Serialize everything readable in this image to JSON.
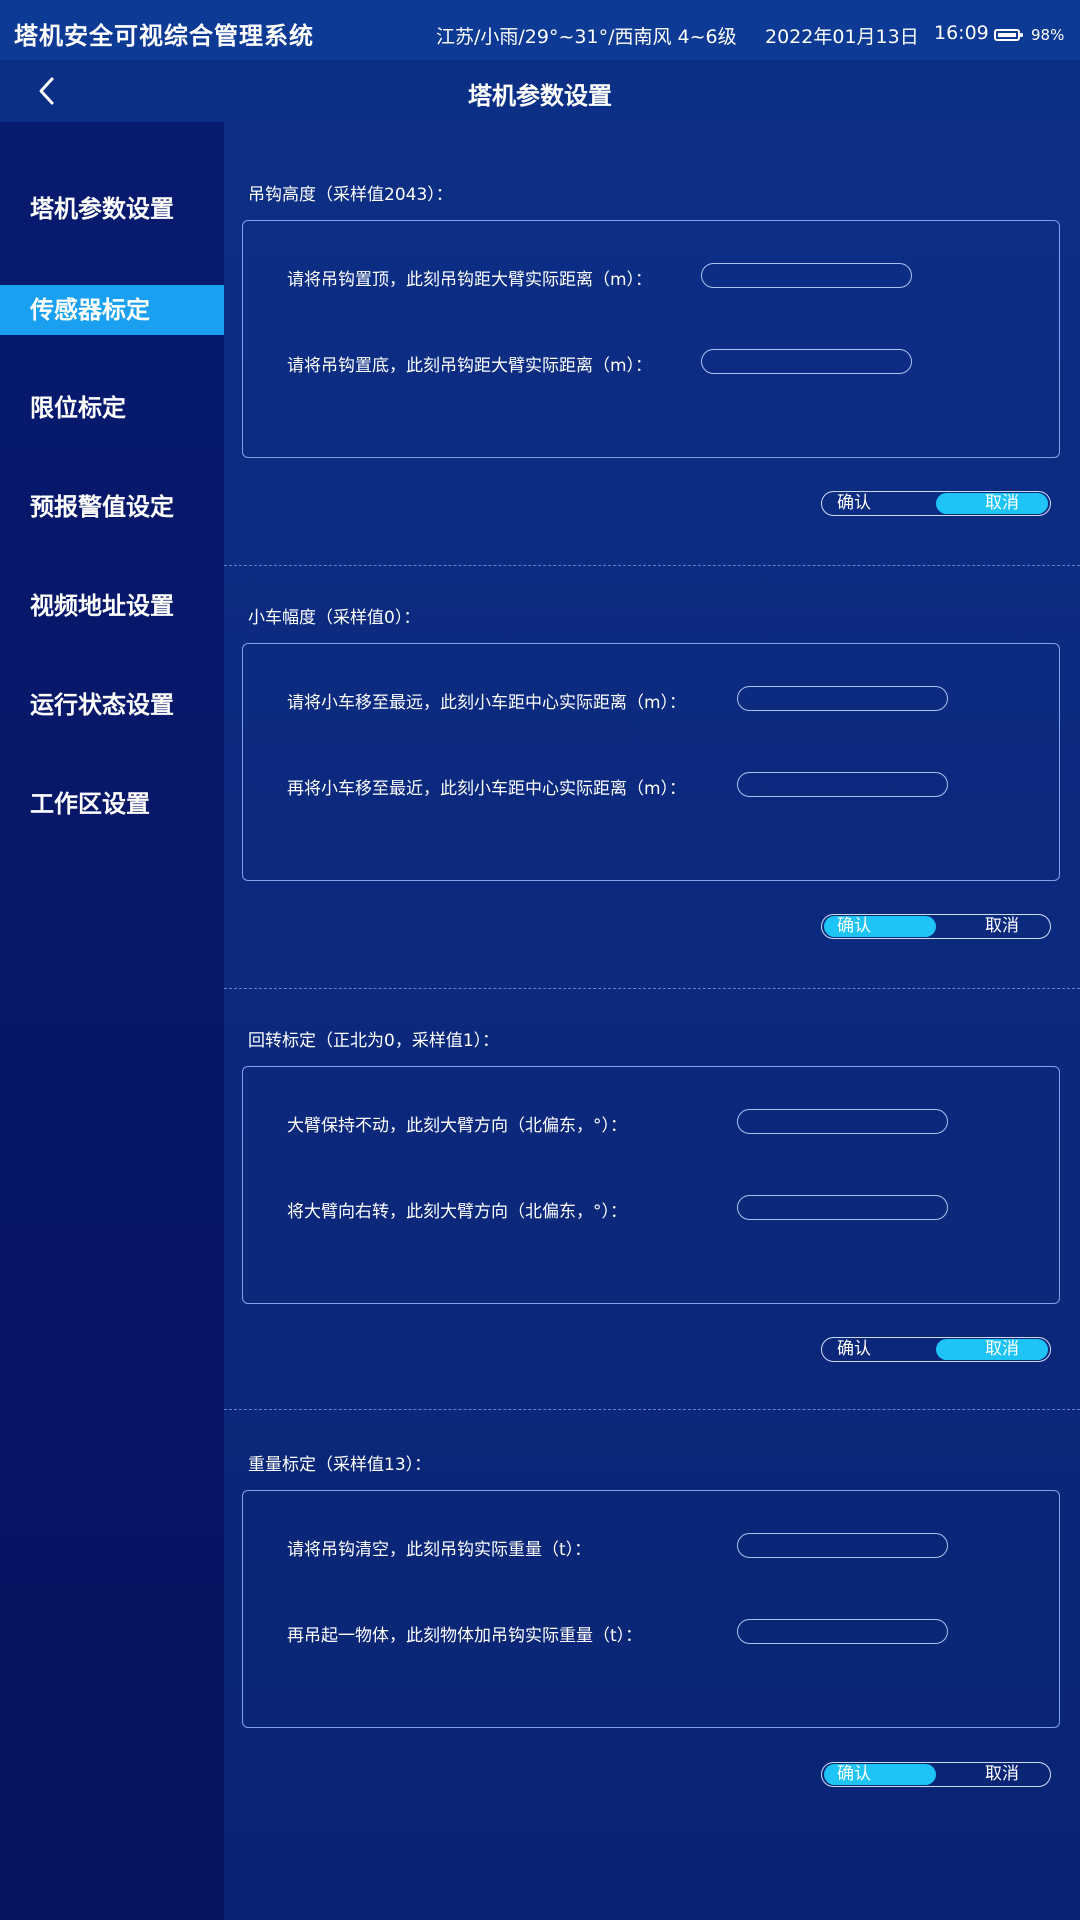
{
  "status_bar": {
    "app_title": "塔机安全可视综合管理系统",
    "weather": "江苏/小雨/29°~31°/西南风 4~6级",
    "date": "2022年01月13日",
    "time": "16:09",
    "battery": "98%"
  },
  "nav": {
    "back_icon": "chevron-left-icon",
    "title": "塔机参数设置"
  },
  "sidebar": {
    "items": [
      {
        "label": "塔机参数设置",
        "active": false
      },
      {
        "label": "传感器标定",
        "active": true
      },
      {
        "label": "限位标定",
        "active": false
      },
      {
        "label": "预报警值设定",
        "active": false
      },
      {
        "label": "视频地址设置",
        "active": false
      },
      {
        "label": "运行状态设置",
        "active": false
      },
      {
        "label": "工作区设置",
        "active": false
      }
    ]
  },
  "sections": [
    {
      "title": "吊钩高度（采样值2043）：",
      "fields": [
        {
          "label": "请将吊钩置顶，此刻吊钩距大臂实际距离（m）：",
          "value": ""
        },
        {
          "label": "请将吊钩置底，此刻吊钩距大臂实际距离（m）：",
          "value": ""
        }
      ],
      "confirm_label": "确认",
      "cancel_label": "取消",
      "highlighted": "cancel"
    },
    {
      "title": "小车幅度（采样值0）：",
      "fields": [
        {
          "label": "请将小车移至最远，此刻小车距中心实际距离（m）：",
          "value": ""
        },
        {
          "label": "再将小车移至最近，此刻小车距中心实际距离（m）：",
          "value": ""
        }
      ],
      "confirm_label": "确认",
      "cancel_label": "取消",
      "highlighted": "confirm"
    },
    {
      "title": "回转标定（正北为0，采样值1）：",
      "fields": [
        {
          "label": "大臂保持不动，此刻大臂方向（北偏东，°）：",
          "value": ""
        },
        {
          "label": "将大臂向右转，此刻大臂方向（北偏东，°）：",
          "value": ""
        }
      ],
      "confirm_label": "确认",
      "cancel_label": "取消",
      "highlighted": "cancel"
    },
    {
      "title": "重量标定（采样值13）：",
      "fields": [
        {
          "label": "请将吊钩清空，此刻吊钩实际重量（t）：",
          "value": ""
        },
        {
          "label": "再吊起一物体，此刻物体加吊钩实际重量（t）：",
          "value": ""
        }
      ],
      "confirm_label": "确认",
      "cancel_label": "取消",
      "highlighted": "confirm"
    }
  ],
  "colors": {
    "accent": "#1ec4f5",
    "sidebar_active": "#1aa0f0",
    "background": "#0b2a7c"
  }
}
